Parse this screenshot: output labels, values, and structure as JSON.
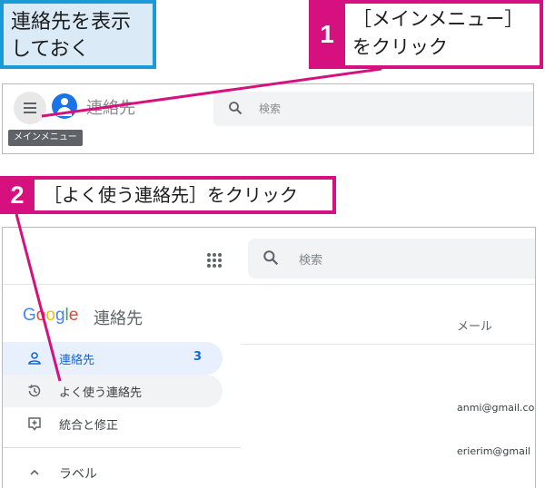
{
  "caption": "連絡先を表示\nしておく",
  "step1": {
    "number": "1",
    "text": "［メインメニュー］\nをクリック"
  },
  "step2": {
    "number": "2",
    "text": "［よく使う連絡先］をクリック"
  },
  "screen1": {
    "app_name": "連絡先",
    "search_placeholder": "検索",
    "tooltip": "メインメニュー"
  },
  "screen2": {
    "brand_letters": [
      "G",
      "o",
      "o",
      "g",
      "l",
      "e"
    ],
    "app_name": "連絡先",
    "search_placeholder": "検索",
    "nav": {
      "contacts": {
        "label": "連絡先",
        "count": "3"
      },
      "frequent": {
        "label": "よく使う連絡先"
      },
      "merge": {
        "label": "統合と修正"
      },
      "labels": {
        "label": "ラベル"
      }
    },
    "column_header": "メール",
    "emails": [
      "anmi@gmail.co",
      "erierim@gmail"
    ]
  },
  "colors": {
    "accent": "#d6107e",
    "caption_border": "#1a9ad6",
    "caption_fill": "#dbeaf7",
    "google_blue": "#4285f4",
    "google_red": "#ea4335",
    "google_yellow": "#fbbc05",
    "google_green": "#34a853"
  }
}
